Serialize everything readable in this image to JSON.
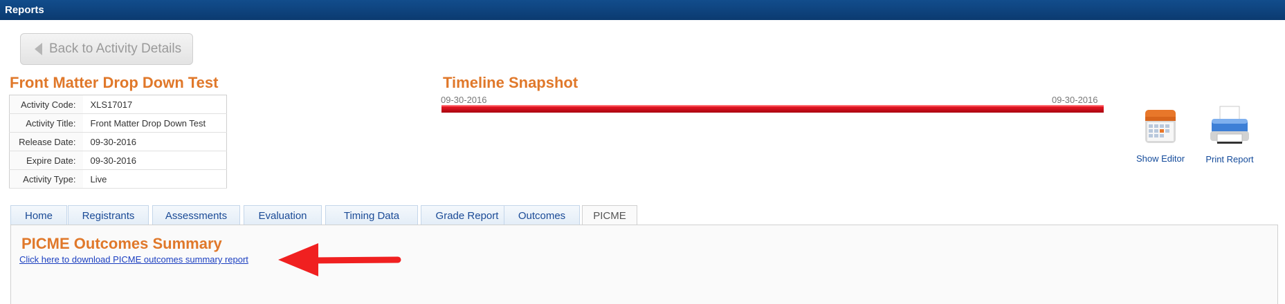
{
  "header": {
    "title": "Reports"
  },
  "back_button": {
    "label": "Back to Activity Details"
  },
  "activity": {
    "heading": "Front Matter Drop Down Test",
    "rows": [
      {
        "label": "Activity Code:",
        "value": "XLS17017"
      },
      {
        "label": "Activity Title:",
        "value": "Front Matter Drop Down Test"
      },
      {
        "label": "Release Date:",
        "value": "09-30-2016"
      },
      {
        "label": "Expire Date:",
        "value": "09-30-2016"
      },
      {
        "label": "Activity Type:",
        "value": "Live"
      }
    ]
  },
  "timeline": {
    "title": "Timeline Snapshot",
    "start": "09-30-2016",
    "end": "09-30-2016"
  },
  "tools": {
    "show_editor": "Show Editor",
    "print_report": "Print Report"
  },
  "tabs": [
    {
      "label": "Home"
    },
    {
      "label": "Registrants"
    },
    {
      "label": "Assessments"
    },
    {
      "label": "Evaluation"
    },
    {
      "label": "Timing Data"
    },
    {
      "label": "Grade Report"
    },
    {
      "label": "Outcomes"
    },
    {
      "label": "PICME"
    }
  ],
  "active_tab": "PICME",
  "panel": {
    "title": "PICME Outcomes Summary",
    "link": "Click here to download PICME outcomes summary report"
  },
  "colors": {
    "accent": "#e0782a",
    "header_bg": "#0b3a70",
    "link": "#1a3ec0",
    "timeline_bar": "#d4101c",
    "arrow": "#f02020"
  }
}
